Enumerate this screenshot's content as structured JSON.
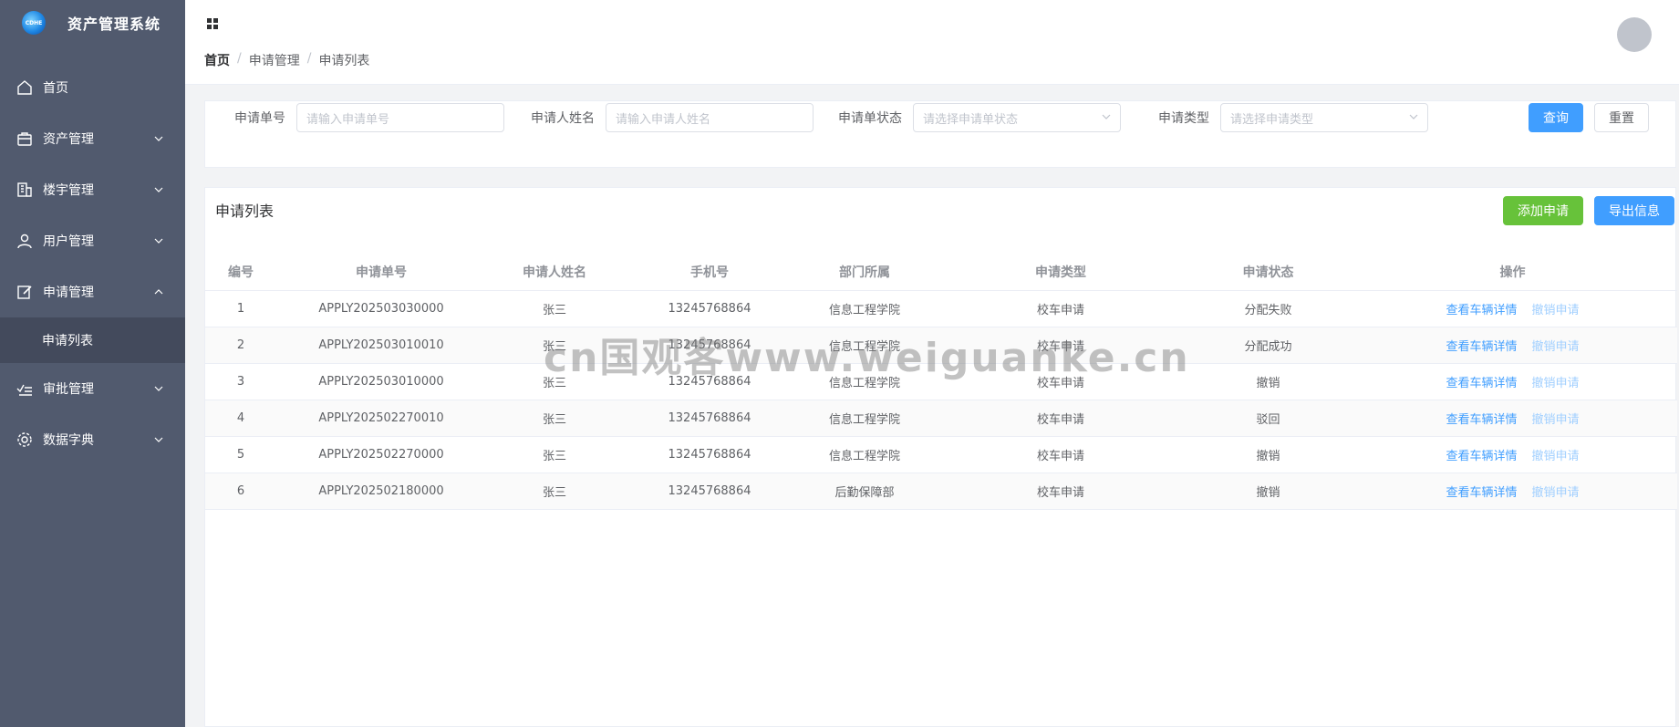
{
  "app": {
    "title": "资产管理系统"
  },
  "sidebar": {
    "items": [
      {
        "label": "首页",
        "icon": "home-icon",
        "expandable": false
      },
      {
        "label": "资产管理",
        "icon": "briefcase-icon",
        "expandable": true
      },
      {
        "label": "楼宇管理",
        "icon": "building-icon",
        "expandable": true
      },
      {
        "label": "用户管理",
        "icon": "user-icon",
        "expandable": true
      },
      {
        "label": "申请管理",
        "icon": "edit-icon",
        "expandable": true,
        "expanded": true
      },
      {
        "label": "审批管理",
        "icon": "checklist-icon",
        "expandable": true
      },
      {
        "label": "数据字典",
        "icon": "gear-icon",
        "expandable": true
      }
    ],
    "sub_item": {
      "label": "申请列表"
    }
  },
  "breadcrumb": {
    "home": "首页",
    "level1": "申请管理",
    "level2": "申请列表",
    "separator": "/"
  },
  "search": {
    "order_no": {
      "label": "申请单号",
      "placeholder": "请输入申请单号"
    },
    "applicant": {
      "label": "申请人姓名",
      "placeholder": "请输入申请人姓名"
    },
    "status": {
      "label": "申请单状态",
      "placeholder": "请选择申请单状态"
    },
    "type": {
      "label": "申请类型",
      "placeholder": "请选择申请类型"
    },
    "query_label": "查询",
    "reset_label": "重置"
  },
  "list": {
    "title": "申请列表",
    "add_label": "添加申请",
    "export_label": "导出信息",
    "columns": [
      "编号",
      "申请单号",
      "申请人姓名",
      "手机号",
      "部门所属",
      "申请类型",
      "申请状态",
      "操作"
    ],
    "rows": [
      {
        "id": "1",
        "order_no": "APPLY202503030000",
        "name": "张三",
        "phone": "13245768864",
        "dept": "信息工程学院",
        "type": "校车申请",
        "status": "分配失败"
      },
      {
        "id": "2",
        "order_no": "APPLY202503010010",
        "name": "张三",
        "phone": "13245768864",
        "dept": "信息工程学院",
        "type": "校车申请",
        "status": "分配成功"
      },
      {
        "id": "3",
        "order_no": "APPLY202503010000",
        "name": "张三",
        "phone": "13245768864",
        "dept": "信息工程学院",
        "type": "校车申请",
        "status": "撤销"
      },
      {
        "id": "4",
        "order_no": "APPLY202502270010",
        "name": "张三",
        "phone": "13245768864",
        "dept": "信息工程学院",
        "type": "校车申请",
        "status": "驳回"
      },
      {
        "id": "5",
        "order_no": "APPLY202502270000",
        "name": "张三",
        "phone": "13245768864",
        "dept": "信息工程学院",
        "type": "校车申请",
        "status": "撤销"
      },
      {
        "id": "6",
        "order_no": "APPLY202502180000",
        "name": "张三",
        "phone": "13245768864",
        "dept": "后勤保障部",
        "type": "校车申请",
        "status": "撤销"
      }
    ],
    "action_view": "查看车辆详情",
    "action_cancel": "撤销申请"
  },
  "watermark": "cn国观客www.weiguanke.cn",
  "colors": {
    "sidebar_bg": "#515a6e",
    "sidebar_active_bg": "#434a5c",
    "primary": "#409eff",
    "success": "#67c23a"
  }
}
